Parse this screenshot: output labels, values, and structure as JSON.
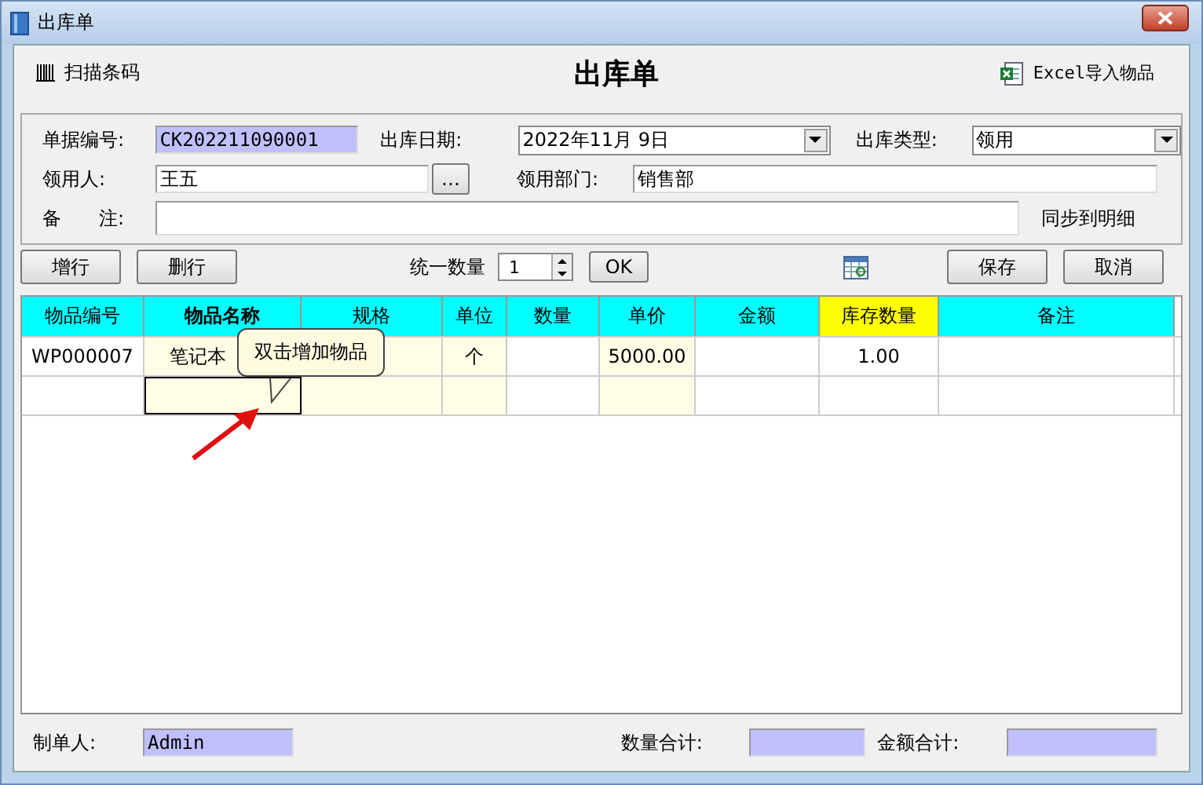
{
  "window": {
    "title": "出库单"
  },
  "toolbar": {
    "scan_label": "扫描条码",
    "heading": "出库单",
    "import_label": "Excel导入物品"
  },
  "form": {
    "doc_no_label": "单据编号:",
    "doc_no": "CK202211090001",
    "date_label": "出库日期:",
    "date": "2022年11月 9日",
    "type_label": "出库类型:",
    "type": "领用",
    "person_label": "领用人:",
    "person": "王五",
    "person_button": "…",
    "dept_label": "领用部门:",
    "dept": "销售部",
    "note_label": "备　　注:",
    "sync_label": "同步到明细"
  },
  "actions": {
    "add_row": "增行",
    "delete_row": "删行",
    "qty_label": "统一数量",
    "qty": "1",
    "ok": "OK",
    "save": "保存",
    "cancel": "取消"
  },
  "table": {
    "columns": [
      {
        "label": "物品编号",
        "color": "#00ffff",
        "bold": false
      },
      {
        "label": "物品名称",
        "color": "#00ffff",
        "bold": true
      },
      {
        "label": "规格",
        "color": "#00ffff",
        "bold": false
      },
      {
        "label": "单位",
        "color": "#00ffff",
        "bold": false
      },
      {
        "label": "数量",
        "color": "#00ffff",
        "bold": false
      },
      {
        "label": "单价",
        "color": "#00ffff",
        "bold": false
      },
      {
        "label": "金额",
        "color": "#00ffff",
        "bold": false
      },
      {
        "label": "库存数量",
        "color": "#ffff00",
        "bold": false
      },
      {
        "label": "备注",
        "color": "#00ffff",
        "bold": false
      }
    ],
    "rows": [
      {
        "cells": [
          {
            "text": "WP000007",
            "focused": false
          },
          {
            "text": "笔记本",
            "focused": false
          },
          {
            "focused": false
          },
          {
            "text": "个",
            "focused": false
          },
          {
            "focused": false
          },
          {
            "text": "5000.00",
            "focused": false
          },
          {
            "focused": false
          },
          {
            "text": "1.00",
            "focused": false
          },
          {
            "focused": false
          }
        ]
      },
      {
        "cells": [
          {
            "focused": false
          },
          {
            "focused": true
          },
          {
            "focused": false
          },
          {
            "focused": false
          },
          {
            "focused": false
          },
          {
            "focused": false
          },
          {
            "focused": false
          },
          {
            "focused": false
          },
          {
            "focused": false
          }
        ]
      }
    ]
  },
  "tooltip": {
    "text": "双击增加物品"
  },
  "footer": {
    "maker_label": "制单人:",
    "maker": "Admin",
    "qty_total_label": "数量合计:",
    "amount_total_label": "金额合计:"
  }
}
